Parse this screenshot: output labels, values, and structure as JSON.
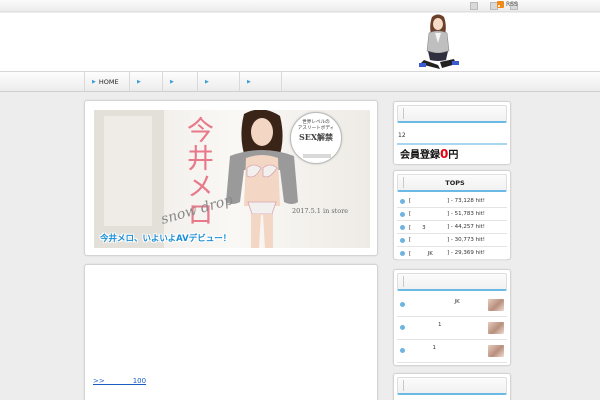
{
  "topbar": {
    "icons": [
      "square-icon",
      "square-icon",
      "square-icon"
    ],
    "rss": {
      "icon": "rss-icon",
      "label": "RSS",
      "color": "#f28a1a"
    }
  },
  "nav": {
    "items": [
      {
        "label": "HOME"
      },
      {
        "label": ""
      },
      {
        "label": ""
      },
      {
        "label": ""
      },
      {
        "label": ""
      }
    ],
    "arrow": "▶",
    "accent": "#3aa0d8"
  },
  "banner": {
    "title": "今井メロ",
    "subtitle": "snow drop",
    "date": "2017.5.1 in store",
    "caption": "今井メロ、いよいよAVデビュー！",
    "badge": {
      "line1": "世界レベルの",
      "line2": "アスリートボディ",
      "line3": "SEX解禁"
    }
  },
  "content": {
    "more_link": ">>　　　　100"
  },
  "sidebar": {
    "member": {
      "title": "",
      "count": "12",
      "text": "会員登録",
      "zero": "0",
      "unit": "円",
      "accent": "#e60012"
    },
    "tops": {
      "title": "TOPS",
      "items": [
        {
          "name": "[",
          "hits": "] - 73,128 hit!"
        },
        {
          "name": "[",
          "hits": "] - 51,783 hit!"
        },
        {
          "name": "[　　3",
          "hits": "] - 44,257 hit!"
        },
        {
          "name": "[",
          "hits": "] - 30,773 hit!"
        },
        {
          "name": "[　　　JK",
          "hits": "] - 29,369 hit!"
        }
      ]
    },
    "posts": {
      "title": "",
      "items": [
        {
          "title": "　　　　　JK"
        },
        {
          "title": "　　1"
        },
        {
          "title": "　1"
        }
      ]
    },
    "extra": {
      "title": ""
    }
  },
  "colors": {
    "accent_blue": "#6bb9e6",
    "link_blue": "#1a5fc4",
    "caption_blue": "#1a8fd8"
  }
}
